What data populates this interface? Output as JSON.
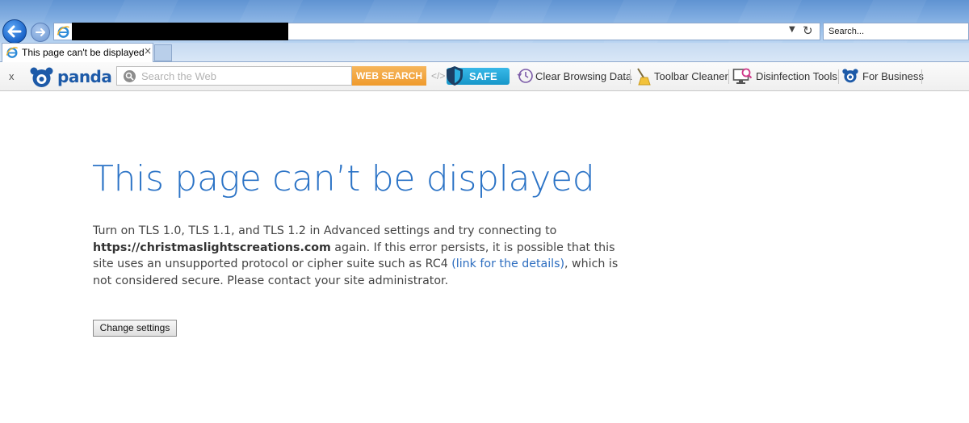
{
  "browser": {
    "search_placeholder": "Search...",
    "address_value": ""
  },
  "tabs": [
    {
      "title": "This page can't be displayed",
      "close": "×"
    }
  ],
  "toolbar": {
    "close": "x",
    "brand": "panda",
    "search_placeholder": "Search the Web",
    "web_search_label": "WEB SEARCH",
    "safe_label": "SAFE",
    "items": [
      {
        "label": "Clear Browsing Data",
        "icon": "clock-history-icon"
      },
      {
        "label": "Toolbar Cleaner",
        "icon": "broom-icon"
      },
      {
        "label": "Disinfection Tools",
        "icon": "monitor-search-icon"
      },
      {
        "label": "For Business",
        "icon": "panda-icon"
      }
    ]
  },
  "error_page": {
    "title": "This page can’t be displayed",
    "line1": "Turn on TLS 1.0, TLS 1.1, and TLS 1.2 in Advanced settings and try connecting to",
    "host": "https://christmaslightscreations.com",
    "line2a": " again. If this error persists, it is possible that this site uses an unsupported protocol or cipher suite such as RC4 ",
    "link": "(link for the details)",
    "line2b": ", which is not considered secure. Please contact your site administrator.",
    "button": "Change settings"
  },
  "colors": {
    "title_blue": "#2b73c6",
    "link_blue": "#2b6cbf",
    "web_search_orange": "#ef9a2c",
    "safe_blue": "#1796c9"
  }
}
